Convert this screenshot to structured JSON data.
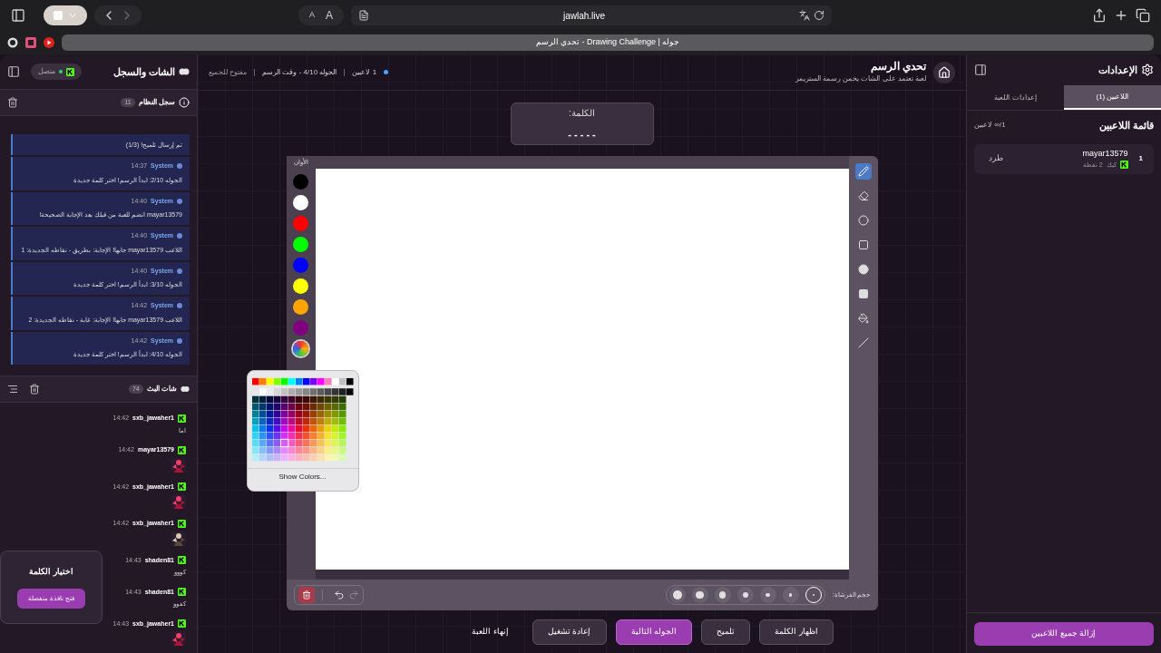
{
  "browser": {
    "smaller_text": "A",
    "larger_text": "A",
    "url": "jawlah.live",
    "tab_title": "تحدي الرسم - Drawing Challenge | جوله"
  },
  "chat_panel": {
    "title": "الشات والسجل",
    "connection": {
      "label": "متصل",
      "connected": true
    },
    "system_log": {
      "title": "سجل النظام",
      "count": "11",
      "entries": [
        {
          "text": "تم إرسال تلميح! (1/3)"
        },
        {
          "sender": "System",
          "time": "14:37",
          "text": "الجوله 2/10: ابدأ الرسم! اختر كلمة جديدة"
        },
        {
          "sender": "System",
          "time": "14:40",
          "text": "mayar13579 انضم للعبة من قبلك بعد الإجابة الصحيحة!"
        },
        {
          "sender": "System",
          "time": "14:40",
          "text": "اللاعب mayar13579 جابها! الإجابة: بطريق - نقاطه الجديدة: 1"
        },
        {
          "sender": "System",
          "time": "14:40",
          "text": "الجوله 3/10: ابدأ الرسم! اختر كلمة جديدة"
        },
        {
          "sender": "System",
          "time": "14:42",
          "text": "اللاعب mayar13579 جابها! الإجابة: غابة - نقاطه الجديدة: 2"
        },
        {
          "sender": "System",
          "time": "14:42",
          "text": "الجوله 4/10: ابدأ الرسم! اختر كلمة جديدة"
        }
      ]
    },
    "chat": {
      "title": "شات البث",
      "count": "74",
      "messages": [
        {
          "user": "sxb_jawaher1",
          "time": "14:42",
          "kind": "text",
          "text": "اما"
        },
        {
          "user": "mayar13579",
          "time": "14:42",
          "kind": "picture"
        },
        {
          "user": "sxb_jawaher1",
          "time": "14:42",
          "kind": "picture"
        },
        {
          "user": "sxb_jawaher1",
          "time": "14:42",
          "kind": "picture"
        },
        {
          "user": "shaden81",
          "time": "14:43",
          "kind": "text",
          "text": "كووو"
        },
        {
          "user": "shaden81",
          "time": "14:43",
          "kind": "text",
          "text": "كفوو"
        },
        {
          "user": "sxb_jawaher1",
          "time": "14:43",
          "kind": "picture"
        }
      ]
    },
    "word_picker": {
      "title": "اختيار الكلمة",
      "button": "فتح نافذة منفصلة"
    }
  },
  "header": {
    "title": "تحدي الرسم",
    "subtitle": "لعبة تعتمد على الشات يخمن رسمة الستريمر",
    "players": "1 لاعبين",
    "round": "الجوله 4/10 - وقت الرسم",
    "access": "مفتوح للجميع"
  },
  "word": {
    "label": "الكلمة:",
    "mask": "- - - - -"
  },
  "canvas": {
    "colors_label": "الأوان",
    "colors": [
      {
        "kind": "solid",
        "color": "#000000",
        "selected": false
      },
      {
        "kind": "solid",
        "color": "#ffffff",
        "selected": false
      },
      {
        "kind": "solid",
        "color": "#ff0000",
        "selected": false
      },
      {
        "kind": "solid",
        "color": "#00ff00",
        "selected": false
      },
      {
        "kind": "solid",
        "color": "#0000ff",
        "selected": false
      },
      {
        "kind": "solid",
        "color": "#ffff00",
        "selected": false
      },
      {
        "kind": "solid",
        "color": "#ffa500",
        "selected": false
      },
      {
        "kind": "solid",
        "color": "#800080",
        "selected": false
      },
      {
        "kind": "custom",
        "selected": true
      }
    ],
    "tools": [
      {
        "kind": "pencil",
        "selected": true
      },
      {
        "kind": "eraser",
        "selected": false
      },
      {
        "kind": "circle",
        "selected": false
      },
      {
        "kind": "rectangle",
        "selected": false
      },
      {
        "kind": "filled-circle",
        "selected": false
      },
      {
        "kind": "filled-rectangle",
        "selected": false
      },
      {
        "kind": "fill",
        "selected": false
      },
      {
        "kind": "line",
        "selected": false
      }
    ],
    "brush_label": "حجم الفرشاة:",
    "brush_sizes": [
      {
        "selected": true
      },
      {
        "selected": false
      },
      {
        "selected": false
      },
      {
        "selected": false
      },
      {
        "selected": false
      },
      {
        "selected": false
      },
      {
        "selected": false
      }
    ],
    "color_picker": {
      "button": "Show Colors..."
    }
  },
  "actions": [
    {
      "label": "اظهار الكلمة",
      "kind": "secondary"
    },
    {
      "label": "تلميح",
      "kind": "secondary"
    },
    {
      "label": "الجوله التالية",
      "kind": "primary"
    },
    {
      "label": "إعادة تشغيل",
      "kind": "secondary"
    },
    {
      "label": "إنهاء اللعبة",
      "kind": "plain"
    }
  ],
  "settings": {
    "title": "الإعدادات",
    "tabs": [
      {
        "label": "اللاعبين (1)",
        "selected": true
      },
      {
        "label": "إعدادات اللعبة",
        "selected": false
      }
    ],
    "list_title": "قائمة اللاعبين",
    "player_count": "1/∞ لاعبين",
    "players": [
      {
        "rank": "1",
        "name": "mayar13579",
        "platform": "كيك",
        "points": "2 نقطة",
        "kick": "طرد"
      }
    ],
    "remove_all": "إزالة جميع اللاعبين"
  }
}
